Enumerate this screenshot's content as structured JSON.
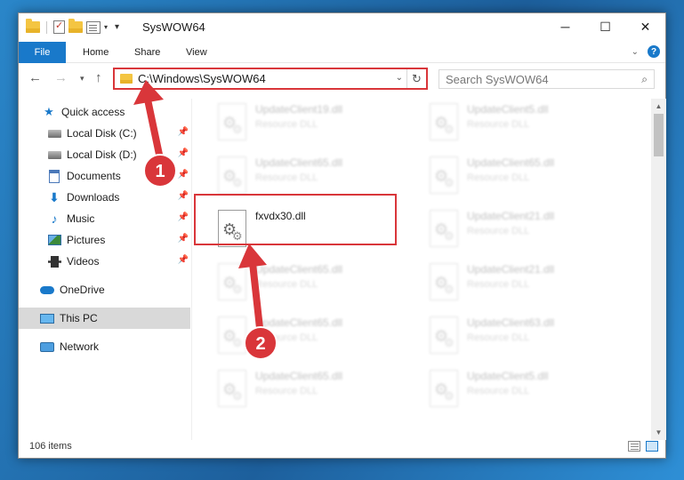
{
  "window": {
    "title": "SysWOW64",
    "controls": {
      "minimize": "─",
      "maximize": "☐",
      "close": "✕"
    }
  },
  "ribbon": {
    "tabs": [
      "File",
      "Home",
      "Share",
      "View"
    ]
  },
  "address": {
    "path": "C:\\Windows\\SysWOW64",
    "search_placeholder": "Search SysWOW64"
  },
  "sidebar": {
    "quick_access": "Quick access",
    "items": [
      {
        "label": "Local Disk (C:)"
      },
      {
        "label": "Local Disk (D:)"
      },
      {
        "label": "Documents"
      },
      {
        "label": "Downloads"
      },
      {
        "label": "Music"
      },
      {
        "label": "Pictures"
      },
      {
        "label": "Videos"
      }
    ],
    "onedrive": "OneDrive",
    "this_pc": "This PC",
    "network": "Network"
  },
  "files": {
    "left": [
      {
        "name": "UpdateClient19.dll",
        "type": "Resource DLL"
      },
      {
        "name": "UpdateClient65.dll",
        "type": "Resource DLL"
      },
      {
        "name": "fxvdx30.dll",
        "type": ""
      },
      {
        "name": "UpdateClient65.dll",
        "type": "Resource DLL"
      },
      {
        "name": "UpdateClient65.dll",
        "type": "Resource DLL"
      },
      {
        "name": "UpdateClient65.dll",
        "type": "Resource DLL"
      }
    ],
    "right": [
      {
        "name": "UpdateClient5.dll",
        "type": "Resource DLL"
      },
      {
        "name": "UpdateClient65.dll",
        "type": "Resource DLL"
      },
      {
        "name": "UpdateClient21.dll",
        "type": "Resource DLL"
      },
      {
        "name": "UpdateClient21.dll",
        "type": "Resource DLL"
      },
      {
        "name": "UpdateClient63.dll",
        "type": "Resource DLL"
      },
      {
        "name": "UpdateClient5.dll",
        "type": "Resource DLL"
      }
    ]
  },
  "status": {
    "item_count": "106 items"
  },
  "annotations": {
    "badge1": "1",
    "badge2": "2",
    "color": "#d9363a"
  }
}
